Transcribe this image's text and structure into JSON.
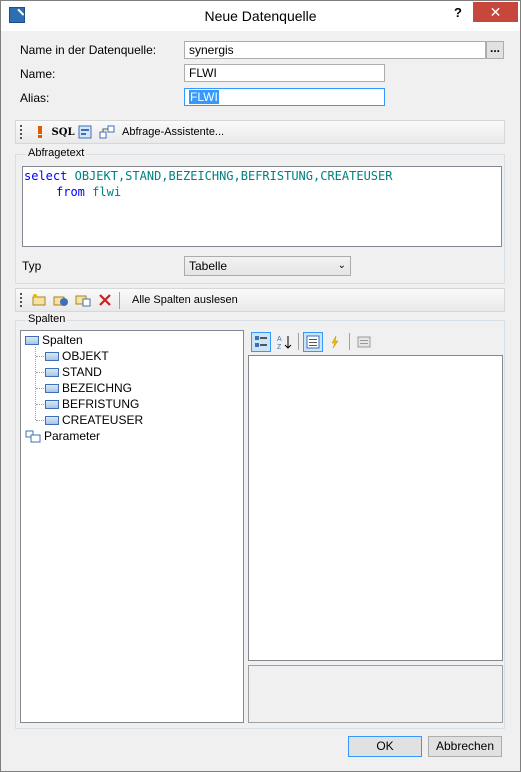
{
  "window": {
    "title": "Neue Datenquelle",
    "help_label": "?",
    "close_label": "✕"
  },
  "form": {
    "datasource_label": "Name in der Datenquelle:",
    "datasource_value": "synergis",
    "datasource_browse_label": "...",
    "name_label": "Name:",
    "name_value": "FLWI",
    "alias_label": "Alias:",
    "alias_value": "FLWI"
  },
  "query_toolbar": {
    "sql_label": "SQL",
    "assistant_label": "Abfrage-Assistente..."
  },
  "query": {
    "group_title": "Abfragetext",
    "line1_kw": "select",
    "line1_cols": "OBJEKT,STAND,BEZEICHNG,BEFRISTUNG,CREATEUSER",
    "line2_kw": "from",
    "line2_table": "flwi"
  },
  "type": {
    "label": "Typ",
    "selected": "Tabelle"
  },
  "columns_toolbar": {
    "read_all_label": "Alle Spalten auslesen"
  },
  "columns": {
    "group_title": "Spalten",
    "root_label": "Spalten",
    "items": [
      "OBJEKT",
      "STAND",
      "BEZEICHNG",
      "BEFRISTUNG",
      "CREATEUSER"
    ],
    "parameter_label": "Parameter"
  },
  "buttons": {
    "ok": "OK",
    "cancel": "Abbrechen"
  },
  "colors": {
    "accent": "#3399ff",
    "close": "#c7473c",
    "keyword": "#0000ff",
    "identifier": "#008080"
  }
}
